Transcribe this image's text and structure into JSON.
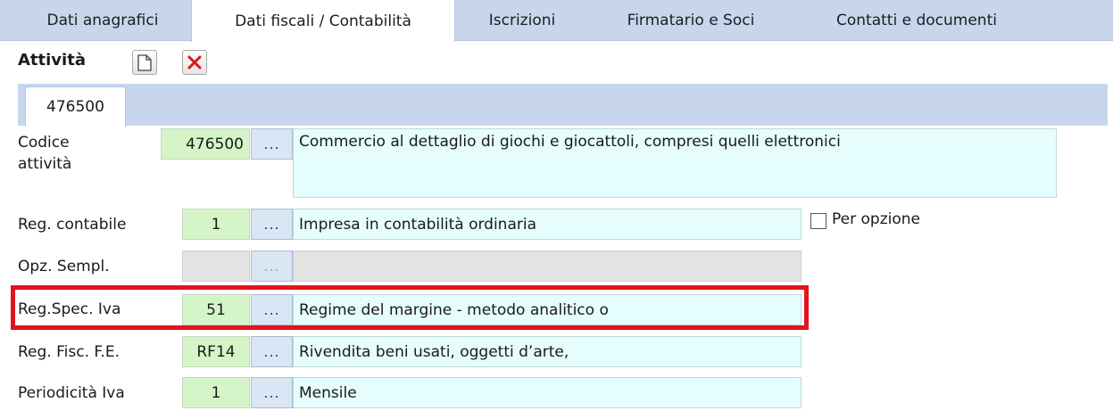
{
  "tabs": [
    {
      "label": "Dati anagrafici"
    },
    {
      "label": "Dati fiscali / Contabilità"
    },
    {
      "label": "Iscrizioni"
    },
    {
      "label": "Firmatario e Soci"
    },
    {
      "label": "Contatti e documenti"
    }
  ],
  "section": {
    "title": "Attività",
    "new_icon": "new-document-icon",
    "delete_icon": "delete-x-icon"
  },
  "subtab": {
    "label": "476500"
  },
  "fields": {
    "codice_attivita": {
      "label_line1": "Codice",
      "label_line2": "attività",
      "code": "476500",
      "lookup": "...",
      "description": "Commercio al dettaglio di giochi e giocattoli, compresi quelli elettronici"
    },
    "reg_contabile": {
      "label": "Reg. contabile",
      "code": "1",
      "lookup": "...",
      "description": "Impresa  in contabilità ordinaria"
    },
    "opz_sempl": {
      "label": "Opz. Sempl.",
      "code": "",
      "lookup": "...",
      "description": ""
    },
    "reg_spec_iva": {
      "label": "Reg.Spec. Iva",
      "code": "51",
      "lookup": "...",
      "description": "Regime del margine - metodo analitico o"
    },
    "reg_fisc_fe": {
      "label": "Reg. Fisc. F.E.",
      "code": "RF14",
      "lookup": "...",
      "description": "Rivendita beni usati, oggetti d’arte,"
    },
    "periodicita_iva": {
      "label": "Periodicità Iva",
      "code": "1",
      "lookup": "...",
      "description": "Mensile"
    }
  },
  "per_opzione": {
    "label": "Per opzione",
    "checked": false
  },
  "colors": {
    "tabbar": "#c7d6ec",
    "code_bg": "#d5f5c8",
    "desc_bg": "#e6fdfd",
    "highlight": "#e0141c"
  }
}
